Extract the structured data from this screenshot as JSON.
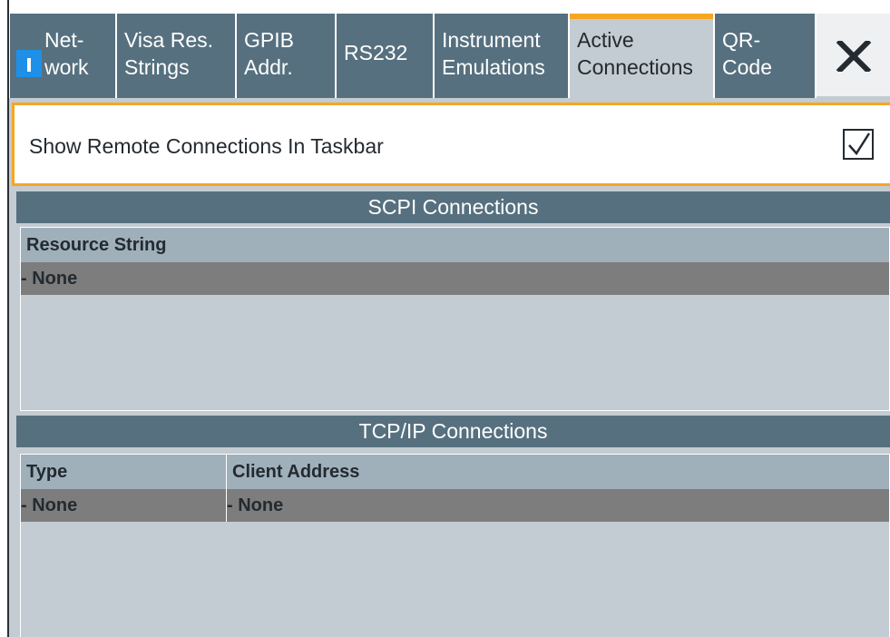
{
  "tabs": [
    {
      "label": "Net-\nwork",
      "icon": "network-icon"
    },
    {
      "label": "Visa Res.\nStrings"
    },
    {
      "label": "GPIB\nAddr."
    },
    {
      "label": "RS232"
    },
    {
      "label": "Instrument\nEmulations"
    },
    {
      "label": "Active\nConnections",
      "active": true
    },
    {
      "label": "QR-\nCode"
    }
  ],
  "close_glyph": "✕",
  "show_remote": {
    "label": "Show Remote Connections In Taskbar",
    "checked": true
  },
  "scpi": {
    "title": "SCPI Connections",
    "columns": [
      "Resource String"
    ],
    "rows": [
      [
        "- None"
      ]
    ]
  },
  "tcp": {
    "title": "TCP/IP Connections",
    "columns": [
      "Type",
      "Client Address"
    ],
    "rows": [
      [
        "- None",
        "- None"
      ]
    ]
  },
  "colors": {
    "tab_bg": "#56707f",
    "active_accent": "#f5a623",
    "panel_bg": "#c3ccd2",
    "icon_blue": "#1e90e8"
  }
}
